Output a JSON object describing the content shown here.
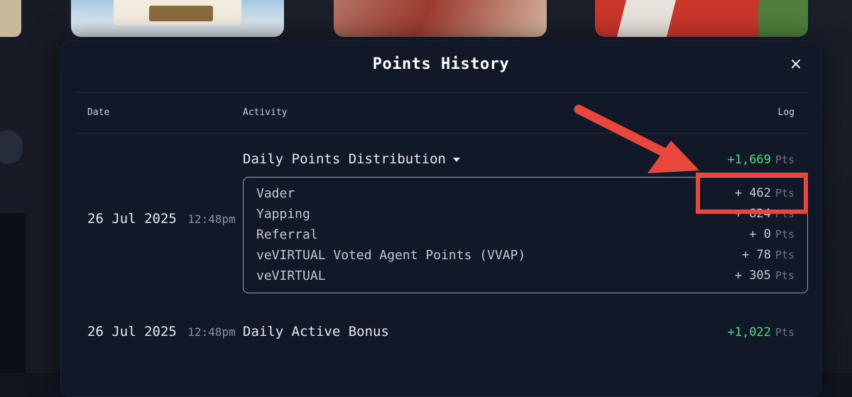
{
  "modal": {
    "title": "Points History",
    "close_icon": "close-icon",
    "columns": {
      "date": "Date",
      "activity": "Activity",
      "log": "Log"
    }
  },
  "entries": [
    {
      "date": "26 Jul 2025",
      "time": "12:48pm",
      "activity": "Daily Points Distribution",
      "amount": "+1,669",
      "unit": "Pts",
      "breakdown": [
        {
          "label": "Vader",
          "value": "+ 462",
          "unit": "Pts"
        },
        {
          "label": "Yapping",
          "value": "+ 824",
          "unit": "Pts"
        },
        {
          "label": "Referral",
          "value": "+ 0",
          "unit": "Pts"
        },
        {
          "label": "veVIRTUAL Voted Agent Points (VVAP)",
          "value": "+ 78",
          "unit": "Pts"
        },
        {
          "label": "veVIRTUAL",
          "value": "+ 305",
          "unit": "Pts"
        }
      ]
    },
    {
      "date": "26 Jul 2025",
      "time": "12:48pm",
      "activity": "Daily Active Bonus",
      "amount": "+1,022",
      "unit": "Pts"
    }
  ],
  "colors": {
    "background": "#101520",
    "modal": "#111827",
    "positive": "#4ade80",
    "annotation": "#e8473c"
  }
}
